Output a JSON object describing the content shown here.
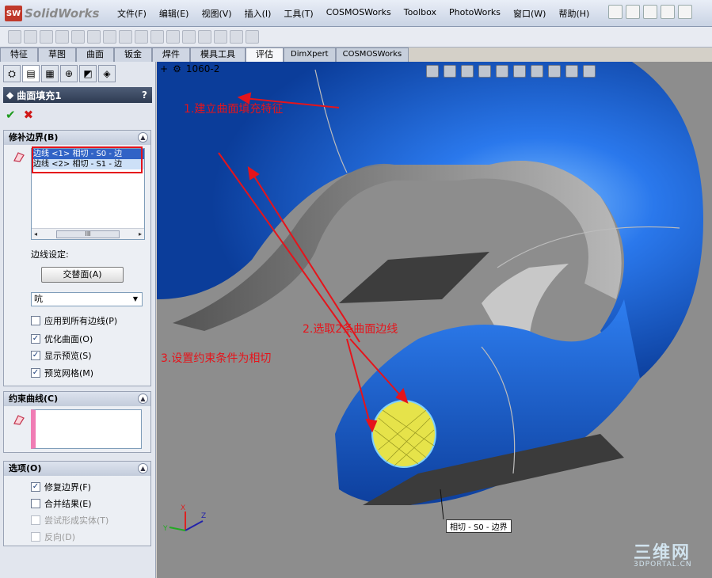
{
  "app": {
    "logo_mark": "SW",
    "logo_text": "SolidWorks"
  },
  "menu": [
    "文件(F)",
    "编辑(E)",
    "视图(V)",
    "插入(I)",
    "工具(T)",
    "COSMOSWorks",
    "Toolbox",
    "PhotoWorks",
    "窗口(W)",
    "帮助(H)"
  ],
  "cm_tabs": [
    "特征",
    "草图",
    "曲面",
    "钣金",
    "焊件",
    "模具工具",
    "评估",
    "DimXpert",
    "COSMOSWorks"
  ],
  "cm_active_tab": "评估",
  "property_manager": {
    "title": "曲面填充1",
    "help": "?",
    "ok": "✔",
    "cancel": "✖"
  },
  "patch_boundary": {
    "title": "修补边界(B)",
    "items": [
      "边线 <1> 相切 - S0 - 边",
      "边线 <2> 相切 - S1 - 边"
    ],
    "scroll_thumb": "III",
    "edge_settings_label": "边线设定:",
    "alternate_face_button": "交替面(A)",
    "curvature_select": "吭",
    "apply_all_edges": "应用到所有边线(P)",
    "optimize_surface": "优化曲面(O)",
    "show_preview": "显示预览(S)",
    "preview_mesh": "预览网格(M)"
  },
  "constraint_curves": {
    "title": "约束曲线(C)"
  },
  "options": {
    "title": "选项(O)",
    "fix_boundary": "修复边界(F)",
    "merge_result": "合并结果(E)",
    "try_form_solid": "尝试形成实体(T)",
    "reverse": "反向(D)"
  },
  "viewport": {
    "doc_title": "1060-2",
    "plus": "+",
    "callout": "相切 - S0 - 边界"
  },
  "annotations": {
    "a1": "1.建立曲面填充特征",
    "a2": "2.选取2条曲面边线",
    "a3": "3.设置约束条件为相切"
  },
  "axes": {
    "x": "X",
    "y": "Y",
    "z": "Z"
  },
  "watermark": {
    "main": "三维网",
    "sub": "3DPORTAL.CN"
  },
  "colors": {
    "model_blue": "#1f63d9",
    "annotation_red": "#e5141b",
    "patch_yellow": "#e6e34a"
  }
}
